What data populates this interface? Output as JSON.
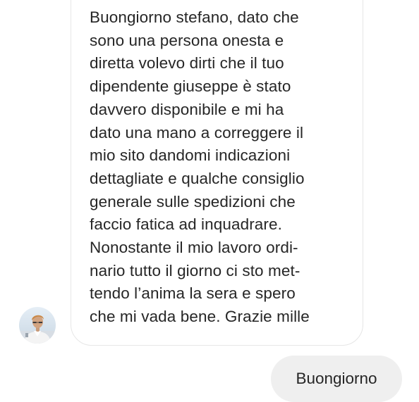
{
  "conversation": {
    "incoming": {
      "lines": [
        "Buongiorno stefano, dato che",
        "sono una persona onesta e",
        "diretta volevo dirti che il tuo",
        "dipendente giuseppe è stato",
        "davvero disponibile e mi ha",
        "dato una mano a correggere il",
        "mio sito dandomi indicazioni",
        "dettagliate e qualche consiglio",
        "generale sulle spedizioni che",
        "faccio fatica ad inquadrare.",
        "Nonostante il mio lavoro ordi-",
        "nario tutto il giorno ci sto met-",
        "tendo l’anima la sera e spero",
        "che mi vada bene. Grazie mille"
      ]
    },
    "outgoing": {
      "text": "Buongiorno"
    },
    "sender": {
      "avatar_icon": "user-avatar-photo"
    }
  },
  "colors": {
    "background": "#ffffff",
    "incoming_border": "#e6e6e6",
    "outgoing_bubble": "#efefef",
    "text": "#262626"
  }
}
